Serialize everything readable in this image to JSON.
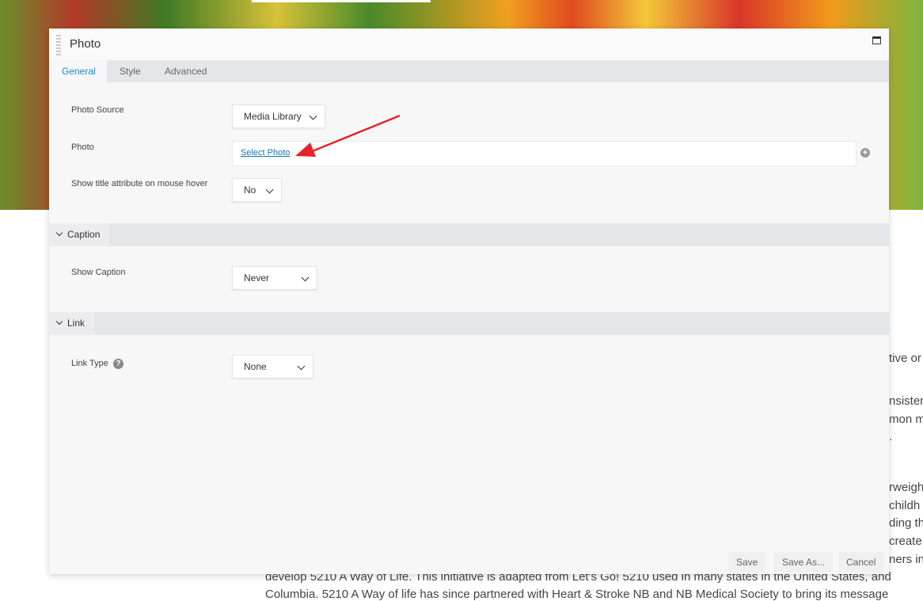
{
  "modal": {
    "title": "Photo",
    "tabs": [
      {
        "label": "General",
        "active": true
      },
      {
        "label": "Style",
        "active": false
      },
      {
        "label": "Advanced",
        "active": false
      }
    ]
  },
  "general": {
    "photo_source_label": "Photo Source",
    "photo_source_value": "Media Library",
    "photo_label": "Photo",
    "select_photo_link": "Select Photo",
    "title_hover_label": "Show title attribute on mouse hover",
    "title_hover_value": "No"
  },
  "caption": {
    "section_label": "Caption",
    "show_caption_label": "Show Caption",
    "show_caption_value": "Never"
  },
  "link": {
    "section_label": "Link",
    "link_type_label": "Link Type",
    "link_type_value": "None"
  },
  "footer": {
    "save": "Save",
    "save_as": "Save As...",
    "cancel": "Cancel"
  },
  "background_text": {
    "fragments": [
      "tive or",
      "nsisten",
      "mon m",
      ".",
      "rweigh",
      "childh",
      "ding th",
      "create",
      "ners in"
    ],
    "line1": "develop 5210 A Way of Life. This initiative is adapted from Let's Go! 5210 used in many states in the United States, and",
    "line2": "Columbia. 5210 A Way of life has since partnered with Heart & Stroke NB and NB Medical Society to bring its message"
  },
  "colors": {
    "accent": "#0e8ed0",
    "link": "#0e7aa8",
    "annotation_arrow": "#e8222a"
  }
}
